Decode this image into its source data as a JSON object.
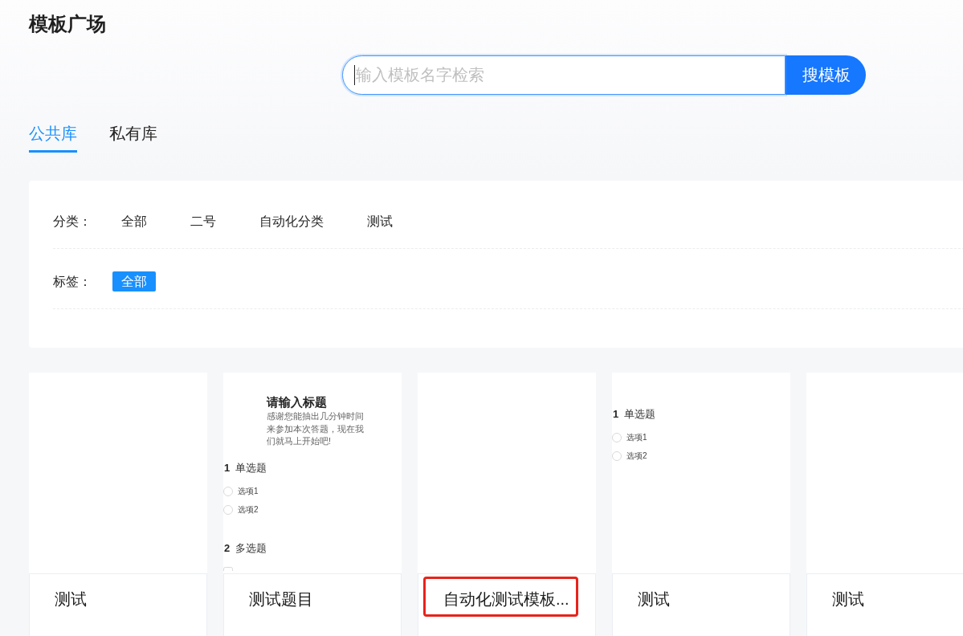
{
  "page": {
    "title": "模板广场"
  },
  "search": {
    "placeholder": "输入模板名字检索",
    "focused": true,
    "button": "搜模板"
  },
  "tabs": [
    {
      "label": "公共库",
      "selected": true
    },
    {
      "label": "私有库",
      "selected": false
    }
  ],
  "filters": [
    {
      "label": "分类：",
      "options": [
        {
          "label": "全部",
          "selected": false
        },
        {
          "label": "二号",
          "selected": false
        },
        {
          "label": "自动化分类",
          "selected": false
        },
        {
          "label": "测试",
          "selected": false
        }
      ]
    },
    {
      "label": "标签：",
      "options": [
        {
          "label": "全部",
          "selected": true
        }
      ]
    }
  ],
  "templates": [
    {
      "title": "测试",
      "highlighted": false
    },
    {
      "title": "测试题目",
      "highlighted": false,
      "preview": {
        "heading": "请输入标题",
        "intro": "感谢您能抽出几分钟时间来参加本次答题，现在我们就马上开始吧!",
        "questions": [
          {
            "number": "1",
            "title": "单选题",
            "kind": "single",
            "options": [
              "选项1",
              "选项2"
            ]
          },
          {
            "number": "2",
            "title": "多选题",
            "kind": "multiple"
          }
        ]
      }
    },
    {
      "title": "自动化测试模板...",
      "highlighted": true
    },
    {
      "title": "测试",
      "highlighted": false,
      "preview": {
        "questions": [
          {
            "number": "1",
            "title": "单选题",
            "kind": "single",
            "options": [
              "选项1",
              "选项2"
            ]
          }
        ]
      }
    },
    {
      "title": "测试",
      "highlighted": false
    }
  ]
}
